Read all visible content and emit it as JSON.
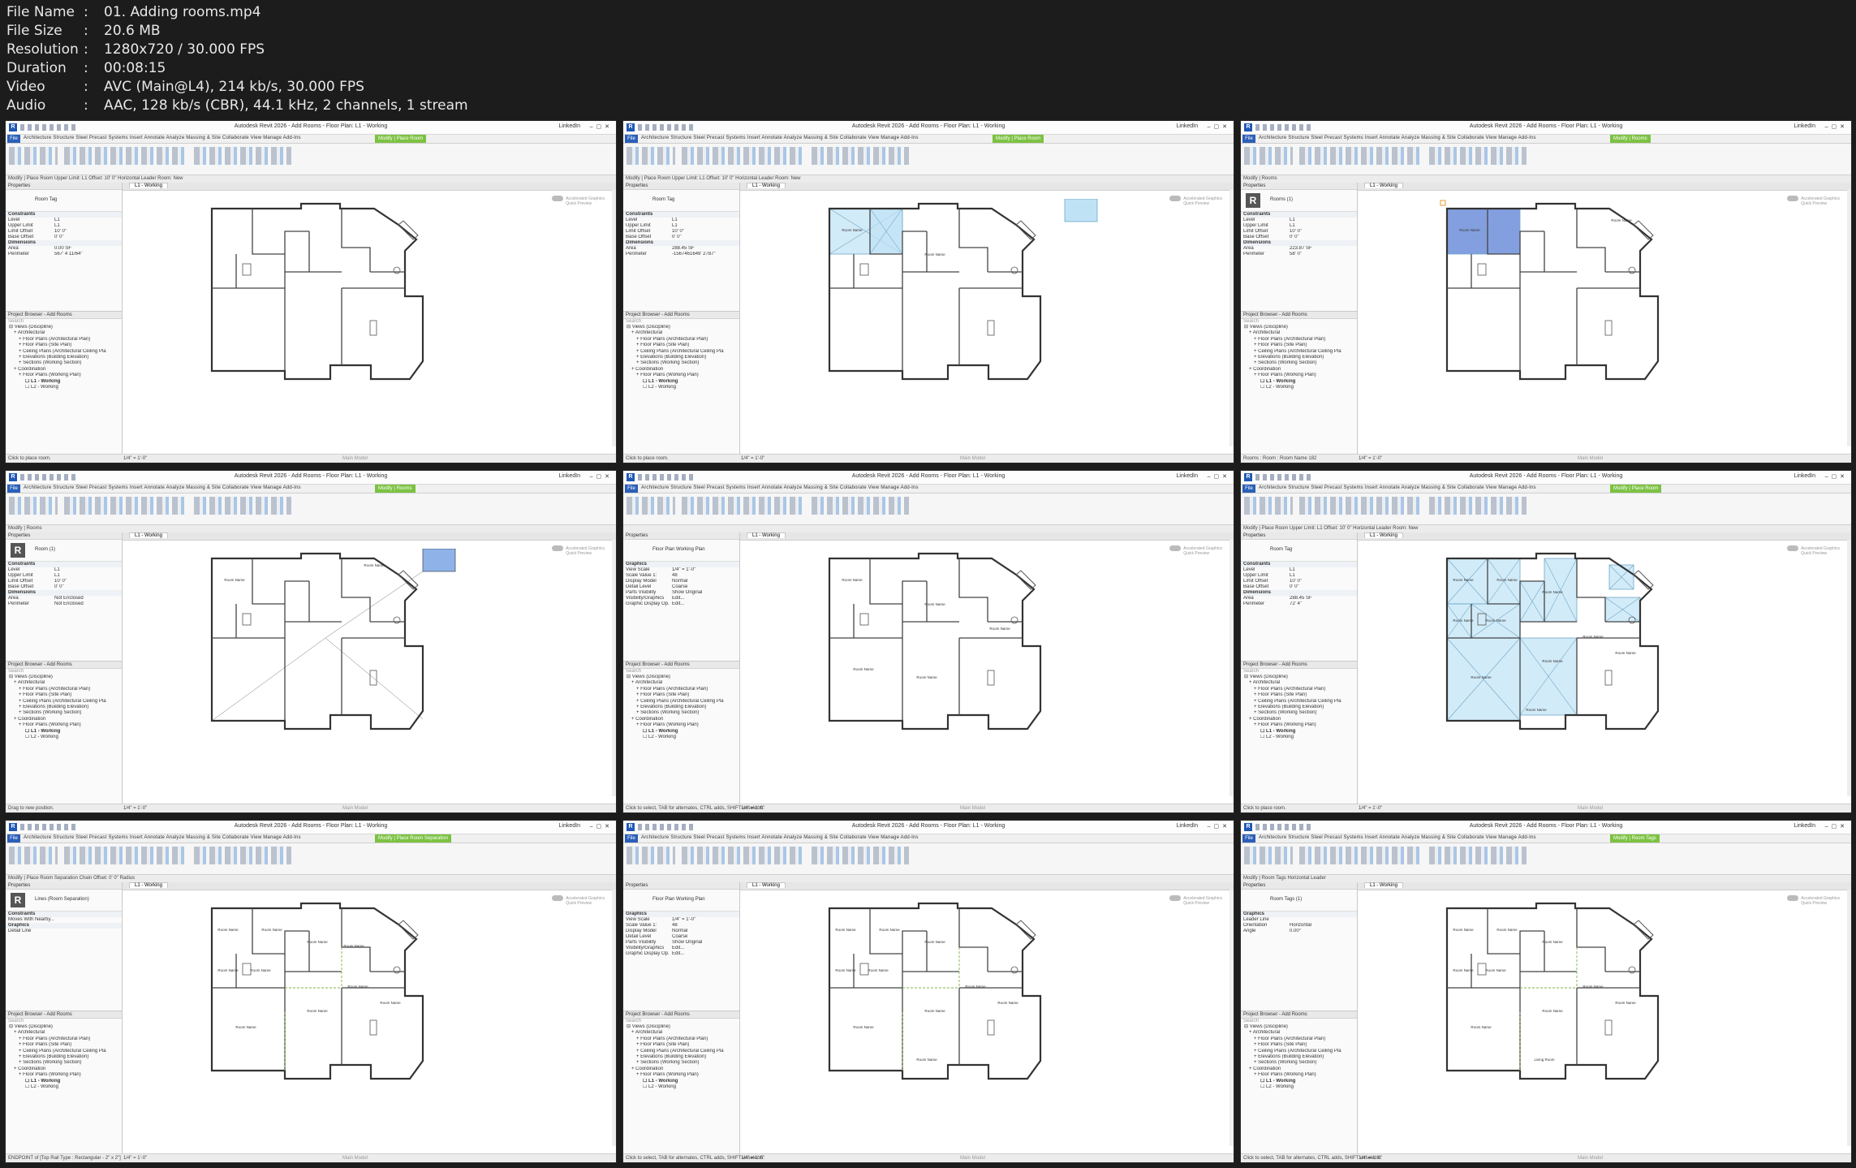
{
  "media_info": [
    {
      "key": "File Name",
      "value": "01. Adding rooms.mp4"
    },
    {
      "key": "File Size",
      "value": "20.6 MB"
    },
    {
      "key": "Resolution",
      "value": "1280x720 / 30.000 FPS"
    },
    {
      "key": "Duration",
      "value": "00:08:15"
    },
    {
      "key": "Video",
      "value": "AVC (Main@L4), 214 kb/s, 30.000 FPS"
    },
    {
      "key": "Audio",
      "value": "AAC, 128 kb/s (CBR), 44.1 kHz, 2 channels, 1 stream"
    }
  ],
  "media_sep": ":",
  "app": {
    "title_l1": "Autodesk Revit 2026 - Add Rooms - Floor Plan: L1 - Working",
    "linkedin": "LinkedIn",
    "file_tab": "File",
    "tab_names": "Architecture   Structure   Steel   Precast   Systems   Insert   Annotate   Analyze   Massing & Site   Collaborate   View   Manage   Add-Ins",
    "view_tab": "L1 - Working",
    "accel_label": "Accelerated Graphics",
    "accel_sub": "Quick Preview",
    "scale": "1/4\" = 1'-0\"",
    "main_model": "Main Model",
    "views_root": "Views (Discipline)",
    "browser_title": "Project Browser - Add Rooms",
    "properties_title": "Properties",
    "search": "Search"
  },
  "tree_items": [
    "Architectural",
    "Floor Plans (Architectural Plan)",
    "Floor Plans (Site Plan)",
    "Ceiling Plans (Architectural Ceiling Pla",
    "Elevations (Building Elevation)",
    "Sections (Working Section)",
    "Coordination",
    "Floor Plans (Working Plan)",
    "L1 - Working",
    "L2 - Working"
  ],
  "tiles": [
    {
      "ctx": "Modify | Place Room",
      "opt": "Modify | Place Room    Upper Limit:  L1    Offset:  10' 0\"    Horizontal    Leader  Room:  New",
      "type": "Room Tag",
      "badge": "",
      "props": [
        [
          "Constraints",
          ""
        ],
        [
          "Level",
          "L1"
        ],
        [
          "Upper Limit",
          "L1"
        ],
        [
          "Limit Offset",
          "10' 0\""
        ],
        [
          "Base Offset",
          "0' 0\""
        ],
        [
          "Dimensions",
          ""
        ],
        [
          "Area",
          "0.00 SF"
        ],
        [
          "Perimeter",
          "567' 4 11/64\""
        ]
      ],
      "status": "Click to place room.",
      "mode": "none"
    },
    {
      "ctx": "Modify | Place Room",
      "opt": "Modify | Place Room    Upper Limit:  L1    Offset:  10' 0\"    Horizontal    Leader  Room:  New",
      "type": "Room Tag",
      "badge": "",
      "props": [
        [
          "Constraints",
          ""
        ],
        [
          "Level",
          "L1"
        ],
        [
          "Upper Limit",
          "L1"
        ],
        [
          "Limit Offset",
          "10' 0\""
        ],
        [
          "Base Offset",
          "0' 0\""
        ],
        [
          "Dimensions",
          ""
        ],
        [
          "Area",
          "288.45 SF"
        ],
        [
          "Perimeter",
          "-1567461649' 2787\""
        ]
      ],
      "status": "Click to place room.",
      "mode": "one"
    },
    {
      "ctx": "Modify | Rooms",
      "opt": "Modify | Rooms",
      "type": "Rooms (1)",
      "badge": "R",
      "props": [
        [
          "Constraints",
          ""
        ],
        [
          "Level",
          "L1"
        ],
        [
          "Upper Limit",
          "L1"
        ],
        [
          "Limit Offset",
          "10' 0\""
        ],
        [
          "Base Offset",
          "0' 0\""
        ],
        [
          "Dimensions",
          ""
        ],
        [
          "Area",
          "223.87 SF"
        ],
        [
          "Perimeter",
          "58' 0\""
        ]
      ],
      "status": "Rooms : Room : Room Name 182",
      "mode": "sel"
    },
    {
      "ctx": "Modify | Rooms",
      "opt": "Modify | Rooms",
      "type": "Room (1)",
      "badge": "R",
      "props": [
        [
          "Constraints",
          ""
        ],
        [
          "Level",
          "L1"
        ],
        [
          "Upper Limit",
          "L1"
        ],
        [
          "Limit Offset",
          "10' 0\""
        ],
        [
          "Base Offset",
          "0' 0\""
        ],
        [
          "Dimensions",
          ""
        ],
        [
          "Area",
          "Not Enclosed"
        ],
        [
          "Perimeter",
          "Not Enclosed"
        ]
      ],
      "status": "Drag to new position.",
      "mode": "drag"
    },
    {
      "ctx": "",
      "opt": "",
      "type": "Floor Plan  Working Plan",
      "badge": "",
      "props": [
        [
          "Graphics",
          ""
        ],
        [
          "View Scale",
          "1/4\" = 1'-0\""
        ],
        [
          "Scale Value 1:",
          "48"
        ],
        [
          "Display Model",
          "Normal"
        ],
        [
          "Detail Level",
          "Coarse"
        ],
        [
          "Parts Visibility",
          "Show Original"
        ],
        [
          "Visibility/Graphics",
          "Edit..."
        ],
        [
          "Graphic Display Op.",
          "Edit..."
        ]
      ],
      "status": "Click to select, TAB for alternates, CTRL adds, SHIFT unselects.",
      "mode": "tags"
    },
    {
      "ctx": "Modify | Place Room",
      "opt": "Modify | Place Room    Upper Limit:  L1    Offset:  10' 0\"    Horizontal    Leader  Room:  New",
      "type": "Room Tag",
      "badge": "",
      "props": [
        [
          "Constraints",
          ""
        ],
        [
          "Level",
          "L1"
        ],
        [
          "Upper Limit",
          "L1"
        ],
        [
          "Limit Offset",
          "10' 0\""
        ],
        [
          "Base Offset",
          "0' 0\""
        ],
        [
          "Dimensions",
          ""
        ],
        [
          "Area",
          "288.45 SF"
        ],
        [
          "Perimeter",
          "72' 4\""
        ]
      ],
      "status": "Click to place room.",
      "mode": "all"
    },
    {
      "ctx": "Modify | Place Room Separation",
      "opt": "Modify | Place Room Separation    Chain   Offset:  0' 0\"    Radius",
      "type": "Lines (Room Separation)",
      "badge": "R",
      "props": [
        [
          "Constraints",
          ""
        ],
        [
          "Moves With Nearby...",
          ""
        ],
        [
          "Graphics",
          ""
        ],
        [
          "Detail Line",
          ""
        ]
      ],
      "status": "ENDPOINT of [Top Rail Type : Rectangular - 2\" x 2\"]",
      "mode": "sep"
    },
    {
      "ctx": "",
      "opt": "",
      "type": "Floor Plan  Working Plan",
      "badge": "",
      "props": [
        [
          "Graphics",
          ""
        ],
        [
          "View Scale",
          "1/4\" = 1'-0\""
        ],
        [
          "Scale Value 1:",
          "48"
        ],
        [
          "Display Model",
          "Normal"
        ],
        [
          "Detail Level",
          "Coarse"
        ],
        [
          "Parts Visibility",
          "Show Original"
        ],
        [
          "Visibility/Graphics",
          "Edit..."
        ],
        [
          "Graphic Display Op.",
          "Edit..."
        ]
      ],
      "status": "Click to select, TAB for alternates, CTRL adds, SHIFT unselects.",
      "mode": "tags2"
    },
    {
      "ctx": "Modify | Room Tags",
      "opt": "Modify | Room Tags    Horizontal    Leader",
      "type": "Room Tags (1)",
      "badge": "",
      "props": [
        [
          "Graphics",
          ""
        ],
        [
          "Leader Line",
          ""
        ],
        [
          "Orientation",
          "Horizontal"
        ],
        [
          "Angle",
          "0.00°"
        ]
      ],
      "status": "Click to select, TAB for alternates, CTRL adds, SHIFT unselects.",
      "mode": "tags3"
    }
  ],
  "room_label": "Room Name",
  "living_label": "Living Room",
  "colors": {
    "room_fill": "#bfe3f5",
    "room_sel": "#5b7fd6",
    "highlight_box": "#e39b2c",
    "ctx_tab": "#7cc242"
  }
}
